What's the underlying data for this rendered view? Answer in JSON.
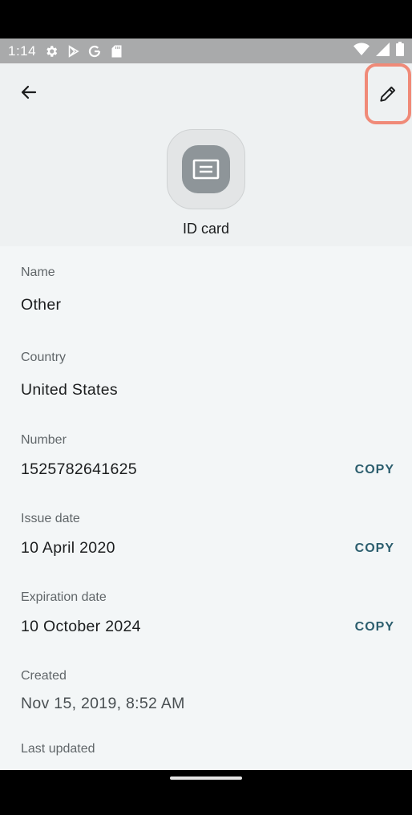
{
  "status": {
    "time": "1:14",
    "left_icons": [
      "gear-icon",
      "play-store-icon",
      "google-icon",
      "sd-card-icon"
    ],
    "right_icons": [
      "wifi-icon",
      "signal-icon",
      "battery-icon"
    ]
  },
  "header": {
    "title": "ID card",
    "item_icon": "id-card-icon",
    "back_icon": "arrow-back-icon",
    "edit_icon": "pencil-icon",
    "highlight_color": "#f08a78"
  },
  "fields": [
    {
      "label": "Name",
      "value": "Other"
    },
    {
      "label": "Country",
      "value": "United States"
    },
    {
      "label": "Number",
      "value": "1525782641625",
      "action": "COPY"
    },
    {
      "label": "Issue date",
      "value": "10 April 2020",
      "action": "COPY"
    },
    {
      "label": "Expiration date",
      "value": "10 October 2024",
      "action": "COPY"
    },
    {
      "label": "Created",
      "value": "Nov 15, 2019, 8:52 AM"
    },
    {
      "label": "Last updated"
    }
  ],
  "colors": {
    "accent": "#2c5e6e",
    "background": "#f3f6f7",
    "header_background": "#eef1f2"
  }
}
